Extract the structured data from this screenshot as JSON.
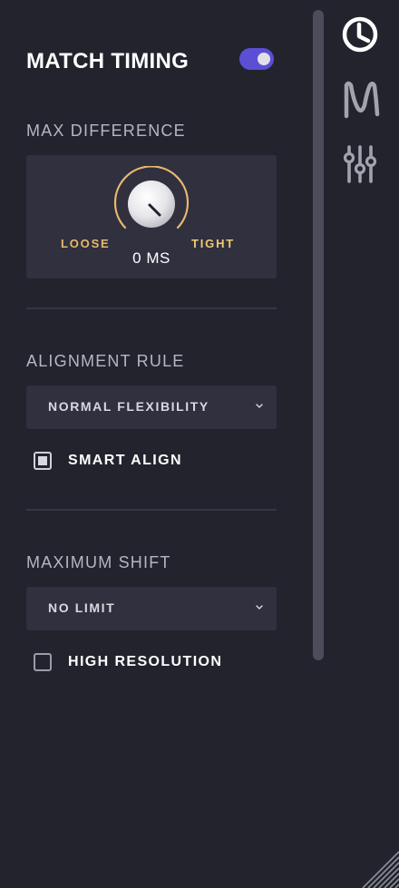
{
  "header": {
    "title": "MATCH TIMING",
    "enabled": true
  },
  "max_difference": {
    "label": "MAX DIFFERENCE",
    "loose_label": "LOOSE",
    "tight_label": "TIGHT",
    "value": "0 MS"
  },
  "alignment_rule": {
    "label": "ALIGNMENT RULE",
    "selected": "NORMAL FLEXIBILITY",
    "smart_align_label": "SMART ALIGN",
    "smart_align_state": "indeterminate"
  },
  "maximum_shift": {
    "label": "MAXIMUM SHIFT",
    "selected": "NO LIMIT",
    "high_resolution_label": "HIGH RESOLUTION",
    "high_resolution_checked": false
  },
  "sidebar": {
    "icons": [
      "clock-icon",
      "waveform-m-icon",
      "sliders-icon"
    ]
  },
  "colors": {
    "background": "#22232d",
    "accent_toggle": "#5b4fd6",
    "knob_ring": "#e8b86d"
  }
}
